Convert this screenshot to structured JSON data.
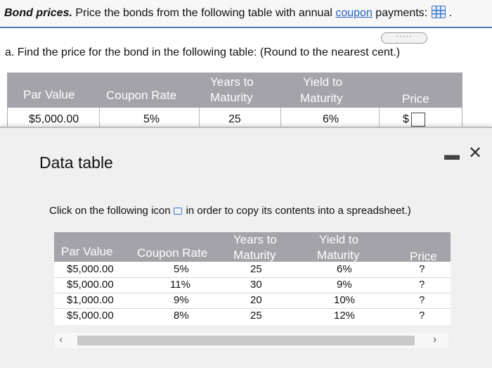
{
  "header": {
    "prefix_bold": "Bond prices.",
    "text_before_link": " Price the bonds from the following table with annual ",
    "link": "coupon",
    "text_after_link": " payments:",
    "trailing": "."
  },
  "more_button": "·····",
  "question": "a. Find the price for the bond in the following table: (Round to the nearest cent.)",
  "main_table": {
    "headers": [
      "Par Value",
      "Coupon Rate",
      "Years to",
      "Maturity",
      "Yield to",
      "Maturity",
      "Price"
    ],
    "row": {
      "par": "$5,000.00",
      "coupon": "5%",
      "years": "25",
      "yield": "6%",
      "currency": "$",
      "price_value": ""
    }
  },
  "popup": {
    "title": "Data table",
    "copy_before": "Click on the following icon",
    "copy_after": "in order to copy its contents into a spreadsheet.)",
    "headers": [
      "Par Value",
      "Coupon Rate",
      "Years to",
      "Maturity",
      "Yield to",
      "Maturity",
      "Price"
    ],
    "rows": [
      {
        "par": "$5,000.00",
        "coupon": "5%",
        "years": "25",
        "yield": "6%",
        "price": "?"
      },
      {
        "par": "$5,000.00",
        "coupon": "11%",
        "years": "30",
        "yield": "9%",
        "price": "?"
      },
      {
        "par": "$1,000.00",
        "coupon": "9%",
        "years": "20",
        "yield": "10%",
        "price": "?"
      },
      {
        "par": "$5,000.00",
        "coupon": "8%",
        "years": "25",
        "yield": "12%",
        "price": "?"
      }
    ]
  },
  "icons": {
    "grid": "spreadsheet-grid-icon",
    "copy": "copy-icon",
    "minimize": "minimize-icon",
    "close": "close-icon",
    "scroll_left": "chevron-left-icon",
    "scroll_right": "chevron-right-icon"
  },
  "colors": {
    "header_gray": "#a3a3a9",
    "link_blue": "#2a62b8",
    "accent_blue": "#4a78b8"
  }
}
